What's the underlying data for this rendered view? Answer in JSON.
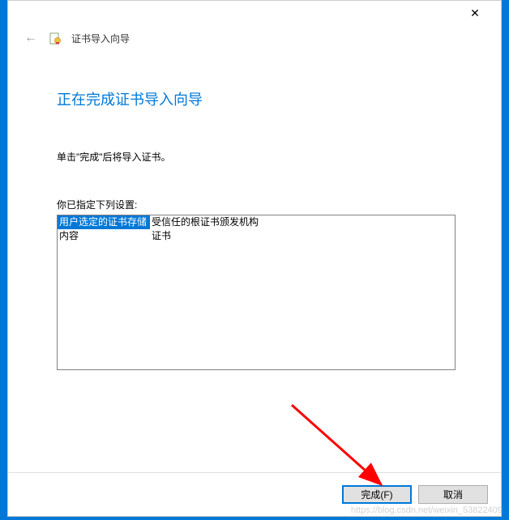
{
  "window": {
    "close_symbol": "✕"
  },
  "header": {
    "back_symbol": "←",
    "title": "证书导入向导"
  },
  "content": {
    "heading": "正在完成证书导入向导",
    "instruction": "单击\"完成\"后将导入证书。",
    "settings_label": "你已指定下列设置:",
    "rows": [
      {
        "key": "用户选定的证书存储",
        "value": "受信任的根证书颁发机构"
      },
      {
        "key": "内容",
        "value": "证书"
      }
    ]
  },
  "footer": {
    "finish": "完成(F)",
    "cancel": "取消"
  },
  "watermark": "https://blog.csdn.net/weixin_53822409"
}
